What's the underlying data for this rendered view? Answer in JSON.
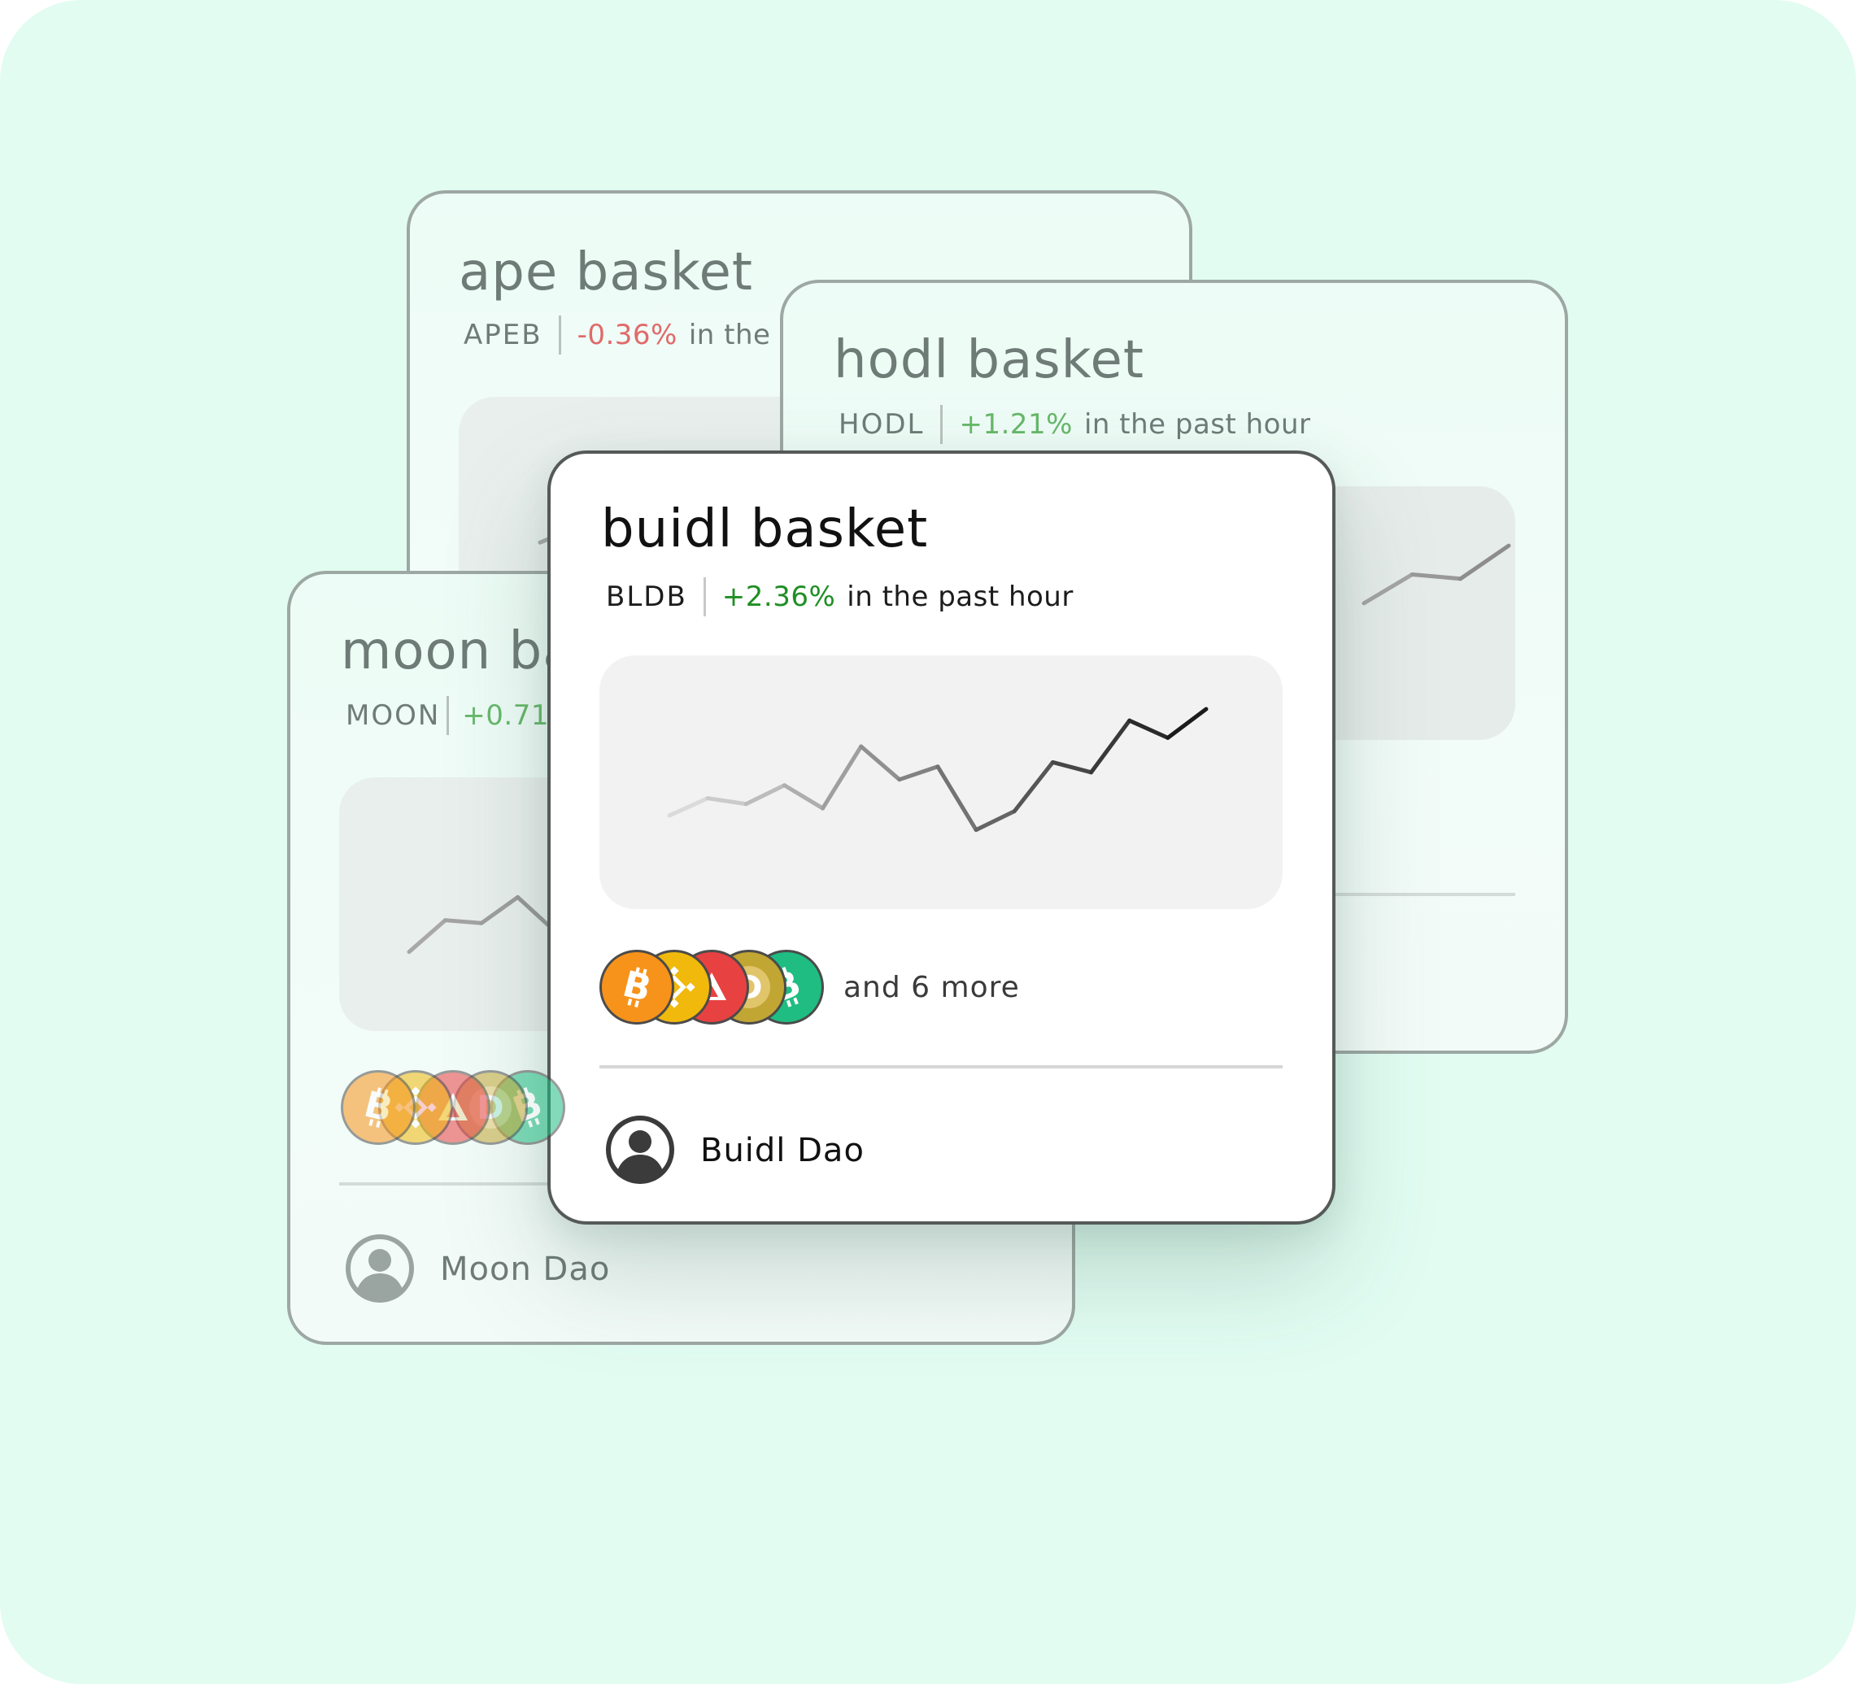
{
  "colors": {
    "background": "#e2fcf2",
    "positive": "#1f8f24",
    "positive_faded": "#67b86a",
    "negative_faded": "#e06a6a",
    "faded_text": "#6f7b77",
    "chart_bg": "#f2f2f2"
  },
  "cards": {
    "ape": {
      "title": "ape basket",
      "ticker": "APEB",
      "change": "-0.36%",
      "change_suffix": "in the"
    },
    "hodl": {
      "title": "hodl basket",
      "ticker": "HODL",
      "change": "+1.21%",
      "change_suffix": "in the past hour"
    },
    "moon": {
      "title": "moon ba",
      "ticker": "MOON",
      "change": "+0.71%",
      "owner": "Moon Dao",
      "coins": [
        "bitcoin",
        "bnb",
        "avalanche",
        "dogecoin",
        "bitcoin-cash"
      ]
    },
    "buidl": {
      "title": "buidl basket",
      "ticker": "BLDB",
      "change": "+2.36%",
      "change_suffix": "in the past hour",
      "coins": [
        "bitcoin",
        "bnb",
        "avalanche",
        "dogecoin",
        "bitcoin-cash"
      ],
      "more": "and 6 more",
      "owner": "Buidl Dao"
    }
  },
  "chart_data": [
    {
      "type": "line",
      "name": "buidl basket past hour",
      "values": [
        30,
        42,
        38,
        51,
        35,
        78,
        55,
        64,
        20,
        33,
        67,
        60,
        96,
        84,
        104
      ],
      "ylim": [
        0,
        130
      ],
      "grid": false
    },
    {
      "type": "line",
      "name": "moon basket partial",
      "values": [
        20,
        42,
        40,
        58,
        35
      ],
      "ylim": [
        0,
        130
      ],
      "grid": false
    },
    {
      "type": "line",
      "name": "hodl basket partial",
      "values": [
        60,
        80,
        77,
        100
      ],
      "ylim": [
        0,
        130
      ],
      "grid": false
    },
    {
      "type": "line",
      "name": "ape basket partial",
      "values": [
        40,
        52
      ],
      "ylim": [
        0,
        130
      ],
      "grid": false
    }
  ]
}
